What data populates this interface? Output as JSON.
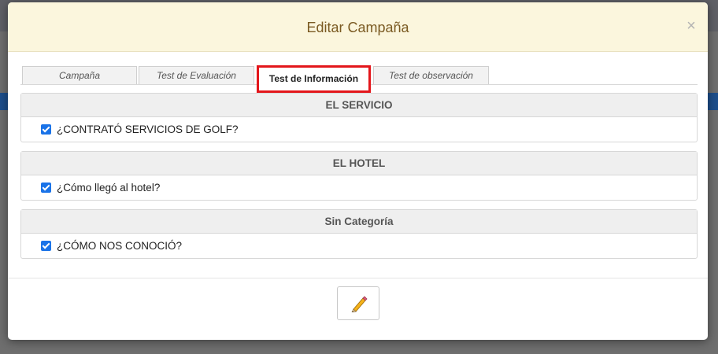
{
  "modal": {
    "title": "Editar Campaña",
    "close_glyph": "×"
  },
  "tabs": [
    {
      "label": "Campaña",
      "active": false
    },
    {
      "label": "Test de Evaluación",
      "active": false
    },
    {
      "label": "Test de Información",
      "active": true
    },
    {
      "label": "Test de observación",
      "active": false
    }
  ],
  "sections": [
    {
      "heading": "EL SERVICIO",
      "items": [
        {
          "label": "¿CONTRATÓ SERVICIOS DE GOLF?",
          "checked": true
        }
      ]
    },
    {
      "heading": "EL HOTEL",
      "items": [
        {
          "label": "¿Cómo llegó al hotel?",
          "checked": true
        }
      ]
    },
    {
      "heading": "Sin Categoría",
      "items": [
        {
          "label": "¿CÓMO NOS CONOCIÓ?",
          "checked": true
        }
      ]
    }
  ],
  "footer": {
    "edit_button_icon": "pencil-icon"
  },
  "colors": {
    "header_bg": "#fbf6dd",
    "title_color": "#7a5a22",
    "active_tab_highlight": "#e3161b",
    "checkbox": "#1a73e8"
  }
}
